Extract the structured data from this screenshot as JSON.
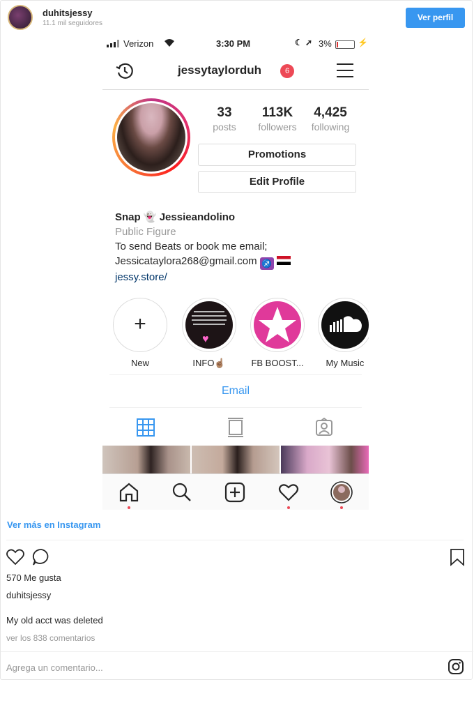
{
  "embed": {
    "username": "duhitsjessy",
    "followers": "11.1 mil seguidores",
    "follow_button": "Ver perfil"
  },
  "status_bar": {
    "carrier": "Verizon",
    "time": "3:30 PM",
    "battery": "3%",
    "battery_level": 0.03
  },
  "nav": {
    "title": "jessytaylorduh",
    "badge": "6"
  },
  "stats": [
    {
      "value": "33",
      "label": "posts"
    },
    {
      "value": "113K",
      "label": "followers"
    },
    {
      "value": "4,425",
      "label": "following"
    }
  ],
  "buttons": {
    "promotions": "Promotions",
    "edit_profile": "Edit Profile"
  },
  "bio": {
    "name_prefix": "Snap",
    "name_suffix": "Jessieandolino",
    "category": "Public Figure",
    "line1": "To send Beats or book me email;",
    "email": "Jessicataylora268@gmail.com",
    "website": "jessy.store/"
  },
  "highlights": [
    {
      "label": "New",
      "icon": "plus-icon"
    },
    {
      "label": "INFO☝🏽",
      "icon": "info-highlight"
    },
    {
      "label": "FB BOOST...",
      "icon": "star-icon"
    },
    {
      "label": "My Music",
      "icon": "soundcloud-icon"
    }
  ],
  "email_button": "Email",
  "colors": {
    "accent_blue": "#3897f0",
    "badge_red": "#ed4956",
    "highlight_pink": "#e0399a",
    "story_ring": "#c13584"
  },
  "post": {
    "view_more": "Ver más en Instagram",
    "likes": "570 Me gusta",
    "caption_user": "duhitsjessy",
    "caption": "My old acct was deleted",
    "comments": "ver los 838 comentarios",
    "add_comment_placeholder": "Agrega un comentario..."
  }
}
